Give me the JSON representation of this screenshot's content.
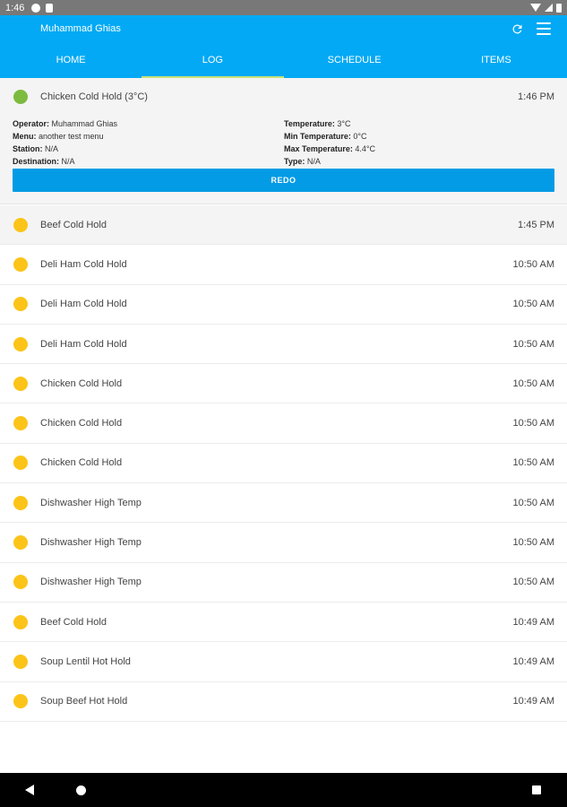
{
  "status_bar": {
    "time": "1:46"
  },
  "app_bar": {
    "title": "Muhammad Ghias",
    "refresh_icon": "refresh-icon",
    "menu_icon": "menu-icon"
  },
  "tabs": [
    {
      "label": "HOME"
    },
    {
      "label": "LOG",
      "active": true
    },
    {
      "label": "SCHEDULE"
    },
    {
      "label": "ITEMS"
    }
  ],
  "expanded_entry": {
    "name": "Chicken Cold Hold (3°C)",
    "time": "1:46 PM",
    "status_color": "#7cbb3e",
    "details": {
      "operator_label": "Operator:",
      "operator": "Muhammad Ghias",
      "menu_label": "Menu:",
      "menu": "another test menu",
      "station_label": "Station:",
      "station": "N/A",
      "destination_label": "Destination:",
      "destination": "N/A",
      "temperature_label": "Temperature:",
      "temperature": "3°C",
      "min_temp_label": "Min Temperature:",
      "min_temp": "0°C",
      "max_temp_label": "Max Temperature:",
      "max_temp": "4.4°C",
      "type_label": "Type:",
      "type": "N/A"
    },
    "redo_label": "REDO"
  },
  "log_entries": [
    {
      "name": "Beef Cold Hold",
      "time": "1:45 PM"
    },
    {
      "name": "Deli Ham Cold Hold",
      "time": "10:50 AM"
    },
    {
      "name": "Deli Ham Cold Hold",
      "time": "10:50 AM"
    },
    {
      "name": "Deli Ham Cold Hold",
      "time": "10:50 AM"
    },
    {
      "name": "Chicken Cold Hold",
      "time": "10:50 AM"
    },
    {
      "name": "Chicken Cold Hold",
      "time": "10:50 AM"
    },
    {
      "name": "Chicken Cold Hold",
      "time": "10:50 AM"
    },
    {
      "name": "Dishwasher High Temp",
      "time": "10:50 AM"
    },
    {
      "name": "Dishwasher High Temp",
      "time": "10:50 AM"
    },
    {
      "name": "Dishwasher High Temp",
      "time": "10:50 AM"
    },
    {
      "name": "Beef Cold Hold",
      "time": "10:49 AM"
    },
    {
      "name": "Soup Lentil Hot Hold",
      "time": "10:49 AM"
    },
    {
      "name": "Soup Beef Hot Hold",
      "time": "10:49 AM"
    }
  ],
  "colors": {
    "primary": "#03a9f4",
    "button": "#039be5",
    "pending": "#fcc419",
    "ok": "#7cbb3e"
  }
}
